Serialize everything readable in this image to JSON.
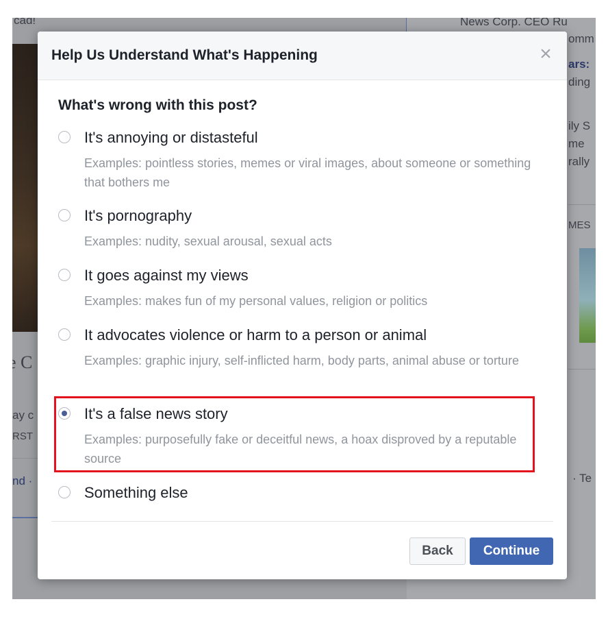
{
  "background": {
    "top_left_text": "cad!",
    "top_right_text": "News Corp. CEO Ru",
    "right_fragments": [
      "omm",
      "ars:",
      "ding",
      "ily S",
      "me",
      "rally",
      "MES"
    ],
    "left_fragments": [
      "e C",
      "ay c",
      "RST",
      "nd ·"
    ],
    "right_bottom_fragment": "· Te"
  },
  "modal": {
    "title": "Help Us Understand What's Happening",
    "close_glyph": "×",
    "question": "What's wrong with this post?",
    "options": [
      {
        "label": "It's annoying or distasteful",
        "description": "Examples: pointless stories, memes or viral images, about someone or something that bothers me",
        "selected": false
      },
      {
        "label": "It's pornography",
        "description": "Examples: nudity, sexual arousal, sexual acts",
        "selected": false
      },
      {
        "label": "It goes against my views",
        "description": "Examples: makes fun of my personal values, religion or politics",
        "selected": false
      },
      {
        "label": "It advocates violence or harm to a person or animal",
        "description": "Examples: graphic injury, self-inflicted harm, body parts, animal abuse or torture",
        "selected": false
      },
      {
        "label": "It's a false news story",
        "description": "Examples: purposefully fake or deceitful news, a hoax disproved by a reputable source",
        "selected": true
      },
      {
        "label": "Something else",
        "description": "",
        "selected": false
      }
    ],
    "back_label": "Back",
    "continue_label": "Continue"
  },
  "colors": {
    "accent": "#4267b2",
    "highlight": "#e2131c",
    "overlay": "#9d9fa3"
  }
}
